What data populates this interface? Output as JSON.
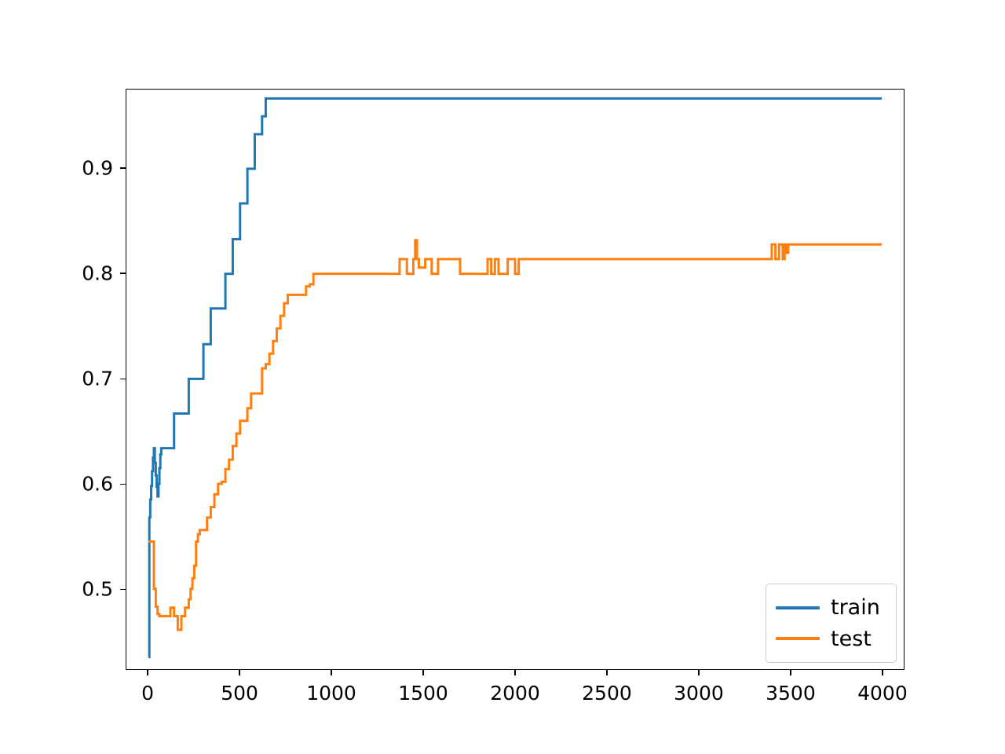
{
  "chart_data": {
    "type": "line",
    "title": "",
    "xlabel": "",
    "ylabel": "",
    "xlim": [
      -120,
      4120
    ],
    "ylim": [
      0.4235,
      0.9755
    ],
    "grid": false,
    "legend_position": "lower right",
    "xticks": [
      0,
      500,
      1000,
      1500,
      2000,
      2500,
      3000,
      3500,
      4000
    ],
    "xtick_labels": [
      "0",
      "500",
      "1000",
      "1500",
      "2000",
      "2500",
      "3000",
      "3500",
      "4000"
    ],
    "yticks": [
      0.5,
      0.6,
      0.7,
      0.8,
      0.9
    ],
    "ytick_labels": [
      "0.5",
      "0.6",
      "0.7",
      "0.8",
      "0.9"
    ],
    "drawstyle": "steps-post",
    "series": [
      {
        "name": "train",
        "color": "#1f77b4",
        "linewidth": 3.0,
        "x": [
          0,
          5,
          10,
          15,
          20,
          25,
          30,
          35,
          40,
          45,
          50,
          55,
          60,
          65,
          70,
          80,
          90,
          100,
          110,
          120,
          140,
          160,
          180,
          200,
          220,
          240,
          260,
          280,
          300,
          320,
          340,
          360,
          380,
          400,
          420,
          440,
          460,
          480,
          500,
          520,
          540,
          560,
          580,
          600,
          620,
          640,
          660,
          700,
          800,
          1000,
          1500,
          2000,
          2500,
          3000,
          3500,
          4000
        ],
        "y": [
          0.435,
          0.568,
          0.585,
          0.598,
          0.612,
          0.625,
          0.634,
          0.62,
          0.608,
          0.597,
          0.588,
          0.6,
          0.615,
          0.628,
          0.634,
          0.634,
          0.634,
          0.634,
          0.634,
          0.634,
          0.667,
          0.667,
          0.667,
          0.667,
          0.7,
          0.7,
          0.7,
          0.7,
          0.733,
          0.733,
          0.767,
          0.767,
          0.767,
          0.767,
          0.8,
          0.8,
          0.833,
          0.833,
          0.867,
          0.867,
          0.9,
          0.9,
          0.933,
          0.933,
          0.95,
          0.967,
          0.967,
          0.967,
          0.967,
          0.967,
          0.967,
          0.967,
          0.967,
          0.967,
          0.967,
          0.967
        ]
      },
      {
        "name": "test",
        "color": "#ff7f0e",
        "linewidth": 3.0,
        "x": [
          0,
          10,
          20,
          30,
          40,
          50,
          60,
          70,
          80,
          90,
          100,
          110,
          120,
          130,
          140,
          150,
          160,
          170,
          180,
          190,
          200,
          210,
          220,
          230,
          240,
          250,
          260,
          270,
          280,
          300,
          320,
          340,
          360,
          380,
          400,
          420,
          440,
          460,
          480,
          500,
          520,
          540,
          560,
          580,
          600,
          620,
          640,
          660,
          680,
          700,
          720,
          740,
          760,
          780,
          800,
          820,
          860,
          880,
          900,
          920,
          1000,
          1200,
          1350,
          1370,
          1390,
          1410,
          1430,
          1445,
          1455,
          1465,
          1475,
          1485,
          1495,
          1510,
          1530,
          1545,
          1560,
          1580,
          1600,
          1700,
          1800,
          1850,
          1870,
          1890,
          1910,
          1960,
          1980,
          2000,
          2020,
          2050,
          2200,
          2500,
          3000,
          3300,
          3400,
          3420,
          3440,
          3460,
          3470,
          3480,
          3490,
          3500,
          3520,
          3600,
          3800,
          4000
        ],
        "y": [
          0.545,
          0.545,
          0.545,
          0.5,
          0.483,
          0.476,
          0.474,
          0.474,
          0.474,
          0.474,
          0.474,
          0.474,
          0.482,
          0.482,
          0.474,
          0.474,
          0.461,
          0.461,
          0.474,
          0.474,
          0.482,
          0.482,
          0.49,
          0.5,
          0.51,
          0.522,
          0.545,
          0.552,
          0.556,
          0.556,
          0.568,
          0.578,
          0.59,
          0.6,
          0.602,
          0.614,
          0.623,
          0.636,
          0.648,
          0.66,
          0.66,
          0.672,
          0.686,
          0.686,
          0.686,
          0.71,
          0.714,
          0.724,
          0.736,
          0.748,
          0.76,
          0.772,
          0.78,
          0.78,
          0.78,
          0.78,
          0.788,
          0.79,
          0.8,
          0.8,
          0.8,
          0.8,
          0.8,
          0.814,
          0.814,
          0.8,
          0.8,
          0.814,
          0.832,
          0.814,
          0.806,
          0.806,
          0.806,
          0.814,
          0.814,
          0.8,
          0.8,
          0.814,
          0.814,
          0.8,
          0.8,
          0.814,
          0.8,
          0.814,
          0.8,
          0.814,
          0.814,
          0.8,
          0.814,
          0.814,
          0.814,
          0.814,
          0.814,
          0.814,
          0.828,
          0.814,
          0.828,
          0.814,
          0.828,
          0.82,
          0.828,
          0.828,
          0.828,
          0.828,
          0.828
        ]
      }
    ]
  },
  "legend": {
    "entries": [
      {
        "label": "train",
        "color": "#1f77b4"
      },
      {
        "label": "test",
        "color": "#ff7f0e"
      }
    ]
  },
  "axes": {
    "background": "#ffffff",
    "spine_color": "#000000"
  }
}
